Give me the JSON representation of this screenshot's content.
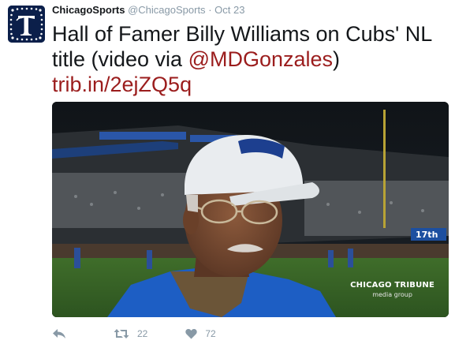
{
  "tweet": {
    "display_name": "ChicagoSports",
    "handle": "@ChicagoSports",
    "separator": "·",
    "date": "Oct 23",
    "text_before": "Hall of Famer Billy Williams on Cubs' NL title (video via ",
    "mention": "@MDGonzales",
    "text_after": ")",
    "link": "trib.in/2ejZQ5q"
  },
  "media": {
    "watermark_main": "CHICAGO TRIBUNE",
    "watermark_sub": "media group",
    "scoreboard_text": "17th"
  },
  "actions": {
    "reply_icon": "reply-icon",
    "retweet_icon": "retweet-icon",
    "retweet_count": "22",
    "like_icon": "heart-icon",
    "like_count": "72"
  },
  "colors": {
    "link": "#9b1d1d",
    "name": "#14171a",
    "meta": "#8899a6",
    "avatar_bg": "#0b1f4a"
  }
}
